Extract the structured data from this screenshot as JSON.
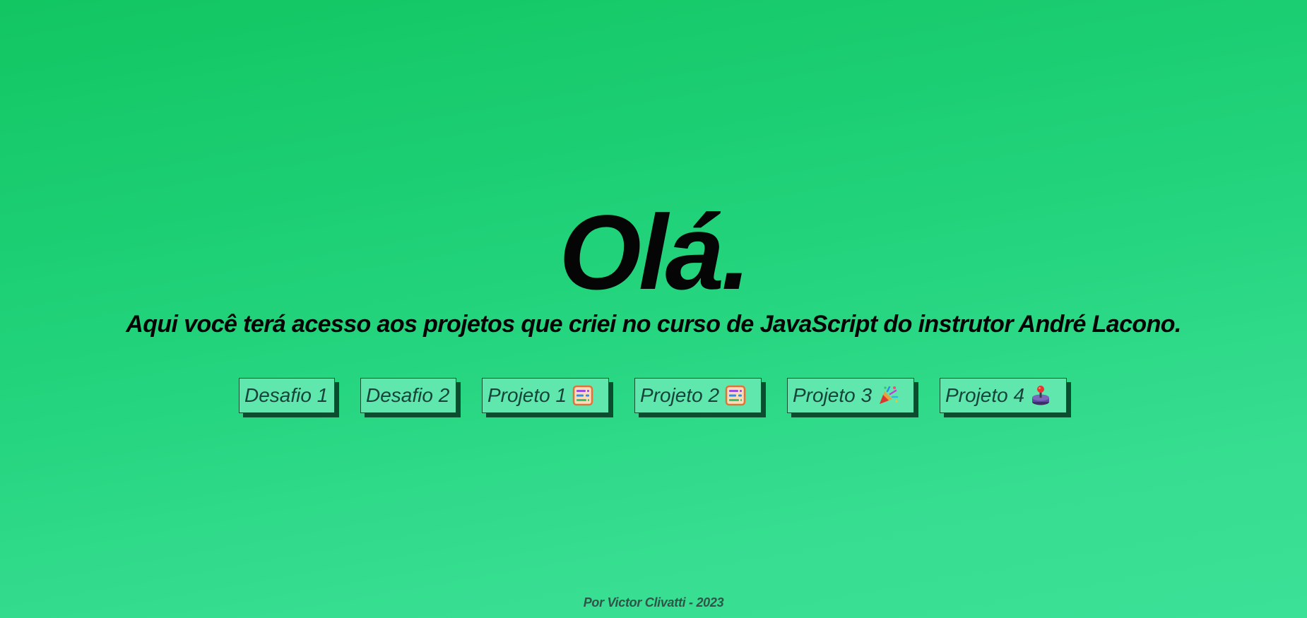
{
  "hero": {
    "title": "Olá.",
    "subtitle": "Aqui você terá acesso aos projetos que criei no curso de JavaScript do instrutor André Lacono."
  },
  "buttons": [
    {
      "label": "Desafio 1",
      "icon": null
    },
    {
      "label": "Desafio 2",
      "icon": null
    },
    {
      "label": "Projeto 1",
      "icon": "abacus-icon"
    },
    {
      "label": "Projeto 2",
      "icon": "abacus-icon"
    },
    {
      "label": "Projeto 3",
      "icon": "party-popper-icon"
    },
    {
      "label": "Projeto 4",
      "icon": "joystick-icon"
    }
  ],
  "footer": {
    "credit": "Por Victor Clivatti - 2023"
  },
  "colors": {
    "background_top": "#12c662",
    "background_bottom": "#3be196",
    "button_fill": "#5fe7ad",
    "button_shadow": "#0c4d2f",
    "text": "#050505"
  }
}
